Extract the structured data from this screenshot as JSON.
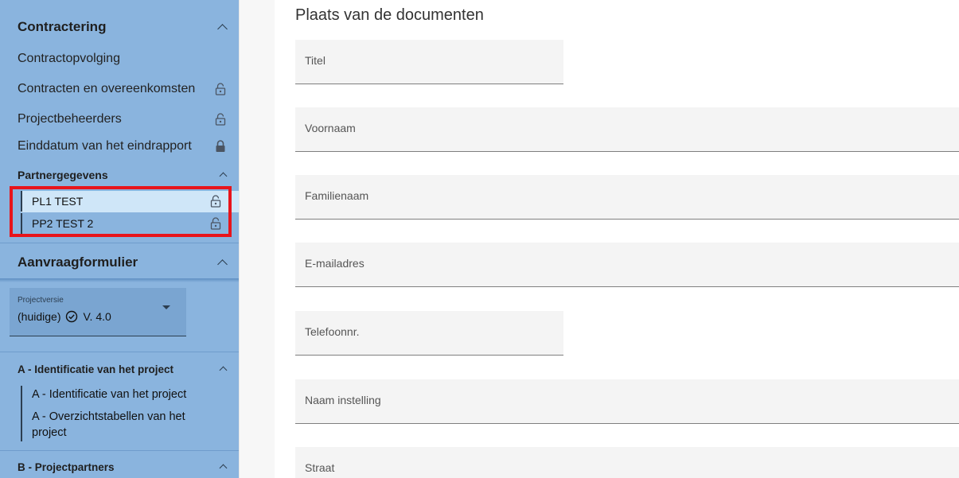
{
  "sidebar": {
    "contractering": {
      "title": "Contractering",
      "items": [
        {
          "label": "Contractopvolging",
          "lock": "none"
        },
        {
          "label": "Contracten en overeenkomsten",
          "lock": "open"
        },
        {
          "label": "Projectbeheerders",
          "lock": "open"
        },
        {
          "label": "Einddatum van het eindrapport",
          "lock": "closed"
        }
      ]
    },
    "partnergegevens": {
      "title": "Partnergegevens",
      "items": [
        {
          "label": "PL1 TEST",
          "lock": "open",
          "selected": true
        },
        {
          "label": "PP2 TEST 2",
          "lock": "open",
          "selected": false
        }
      ]
    },
    "aanvraagformulier": {
      "title": "Aanvraagformulier",
      "select_label": "Projectversie",
      "select_value": "(huidige)",
      "select_version": "V. 4.0",
      "sections": [
        {
          "title": "A - Identificatie van het project",
          "items": [
            "A - Identificatie van het project",
            "A - Overzichtstabellen van het project"
          ]
        },
        {
          "title": "B - Projectpartners",
          "items": []
        }
      ]
    }
  },
  "main": {
    "title": "Plaats van de documenten",
    "fields": [
      {
        "label": "Titel"
      },
      {
        "label": "Voornaam"
      },
      {
        "label": "Familienaam"
      },
      {
        "label": "E-mailadres"
      },
      {
        "label": "Telefoonnr."
      },
      {
        "label": "Naam instelling"
      },
      {
        "label": "Straat"
      }
    ]
  },
  "colors": {
    "sidebar": "#8ab4de",
    "highlight": "#e8141b",
    "selected": "#cfe6f8"
  }
}
